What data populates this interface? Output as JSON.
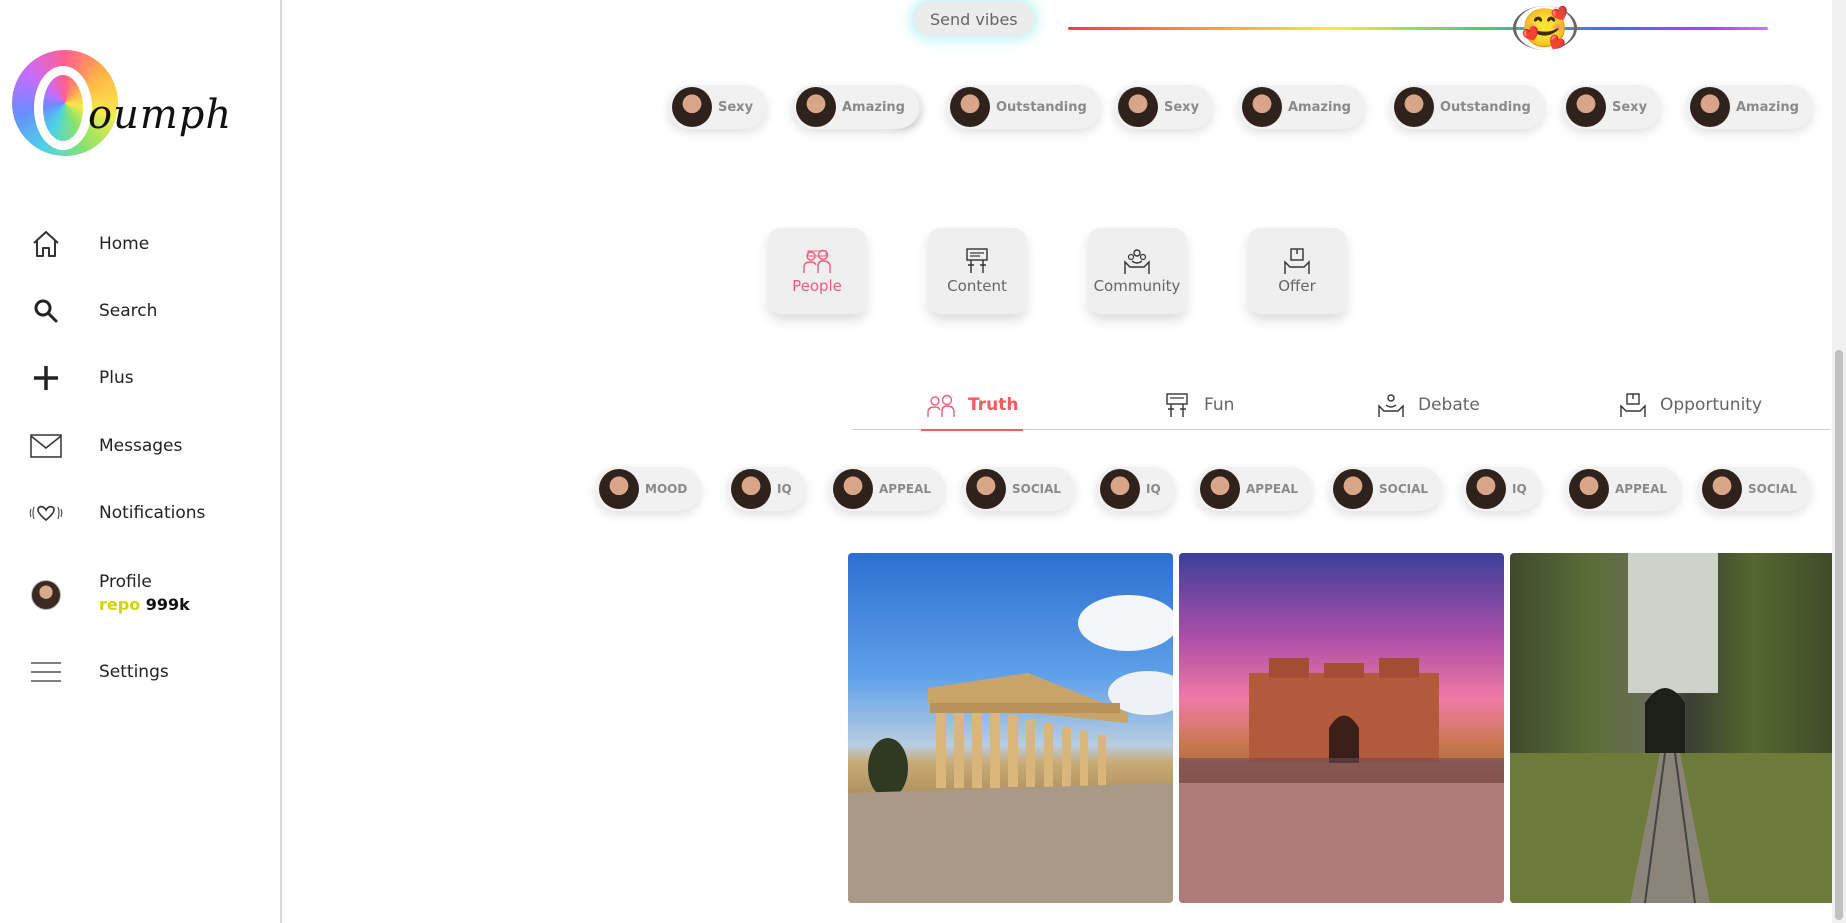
{
  "brand": {
    "name": "oumph"
  },
  "nav": {
    "home": "Home",
    "search": "Search",
    "plus": "Plus",
    "messages": "Messages",
    "notifications": "Notifications",
    "profile": "Profile",
    "repo_word": "repo",
    "repo_count": "999k",
    "settings": "Settings"
  },
  "vibes": {
    "send_label": "Send vibes",
    "thumb_icon": "smiling-face-with-hearts-icon",
    "level": 0.68
  },
  "compliments": [
    "Sexy",
    "Amazing",
    "Outstanding",
    "Sexy",
    "Amazing",
    "Outstanding",
    "Sexy",
    "Amazing"
  ],
  "categories": [
    {
      "label": "People",
      "icon": "people-icon",
      "active": true
    },
    {
      "label": "Content",
      "icon": "content-icon",
      "active": false
    },
    {
      "label": "Community",
      "icon": "community-icon",
      "active": false
    },
    {
      "label": "Offer",
      "icon": "offer-icon",
      "active": false
    }
  ],
  "tabs": [
    {
      "label": "Truth",
      "icon": "people-icon",
      "active": true
    },
    {
      "label": "Fun",
      "icon": "content-icon",
      "active": false
    },
    {
      "label": "Debate",
      "icon": "community-icon",
      "active": false
    },
    {
      "label": "Opportunity",
      "icon": "offer-icon",
      "active": false
    }
  ],
  "traits": [
    "MOOD",
    "IQ",
    "APPEAL",
    "SOCIAL",
    "IQ",
    "APPEAL",
    "SOCIAL",
    "IQ",
    "APPEAL",
    "SOCIAL"
  ],
  "colors": {
    "accent": "#f25c5c",
    "repo": "#d8d300",
    "active_category": "#f25c7a"
  }
}
